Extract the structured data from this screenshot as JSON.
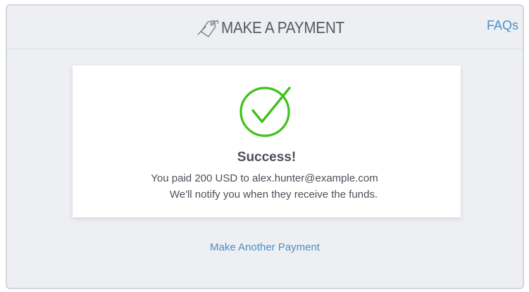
{
  "header": {
    "title": "MAKE A PAYMENT",
    "title_icon": "price-tag-icon",
    "faqs_label": "FAQs"
  },
  "result": {
    "status_icon": "check-circle-icon",
    "heading": "Success!",
    "line1_prefix": "You paid",
    "amount": "200",
    "currency": "USD",
    "line1_to": "to",
    "recipient": "alex.hunter@example.com",
    "line2": "We'll notify you when they receive the funds."
  },
  "actions": {
    "make_another_label": "Make Another Payment"
  },
  "colors": {
    "panel_bg": "#edeff3",
    "card_bg": "#ffffff",
    "success_green": "#3ec21a",
    "link_blue": "#4a8fc7",
    "text_dark": "#4a5058"
  }
}
